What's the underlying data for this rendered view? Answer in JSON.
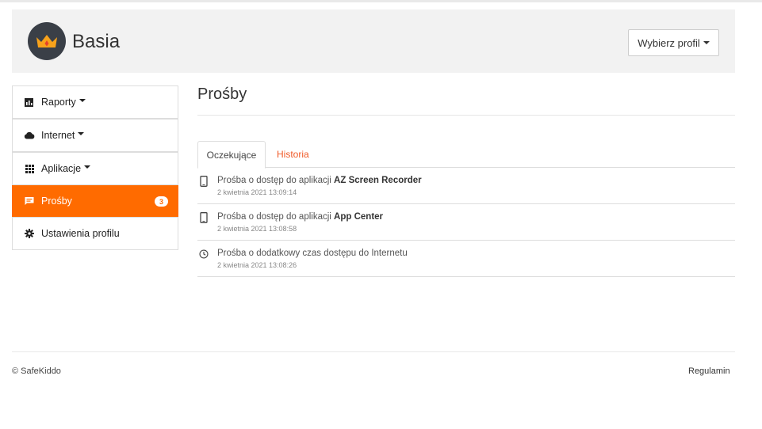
{
  "header": {
    "child_name": "Basia",
    "profile_button": "Wybierz profil",
    "avatar_icon": "crown-icon"
  },
  "sidebar": {
    "items": [
      {
        "label": "Raporty",
        "icon": "bar-chart-icon",
        "dropdown": true
      },
      {
        "label": "Internet",
        "icon": "cloud-icon",
        "dropdown": true
      },
      {
        "label": "Aplikacje",
        "icon": "grid-icon",
        "dropdown": true
      },
      {
        "label": "Prośby",
        "icon": "message-icon",
        "badge": "3",
        "active": true
      },
      {
        "label": "Ustawienia profilu",
        "icon": "gear-icon"
      }
    ]
  },
  "main": {
    "title": "Prośby",
    "tabs": [
      {
        "label": "Oczekujące",
        "active": true
      },
      {
        "label": "Historia",
        "active": false
      }
    ],
    "requests": [
      {
        "icon": "phone-icon",
        "prefix": "Prośba o dostęp do aplikacji ",
        "app": "AZ Screen Recorder",
        "date": "2 kwietnia 2021 13:09:14"
      },
      {
        "icon": "phone-icon",
        "prefix": "Prośba o dostęp do aplikacji ",
        "app": "App Center",
        "date": "2 kwietnia 2021 13:08:58"
      },
      {
        "icon": "clock-icon",
        "prefix": "Prośba o dodatkowy czas dostępu do Internetu",
        "app": "",
        "date": "2 kwietnia 2021 13:08:26"
      }
    ]
  },
  "footer": {
    "copyright": "© SafeKiddo",
    "terms": "Regulamin"
  },
  "colors": {
    "accent": "#ff6b00",
    "link": "#f05a28",
    "header_bg": "#f2f2f2"
  }
}
